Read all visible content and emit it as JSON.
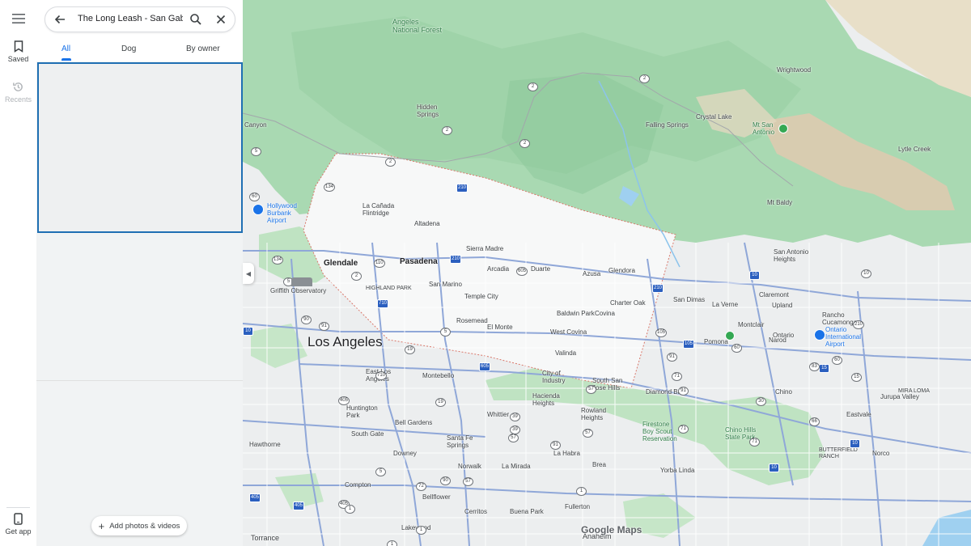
{
  "rail": {
    "saved_label": "Saved",
    "recents_label": "Recents",
    "get_app_label": "Get app"
  },
  "search": {
    "query": "The Long Leash - San Gabriel"
  },
  "tabs": [
    {
      "label": "All",
      "active": true
    },
    {
      "label": "Dog",
      "active": false
    },
    {
      "label": "By owner",
      "active": false
    }
  ],
  "add_photos_label": "Add photos & videos",
  "map": {
    "watermark": "Google Maps",
    "labels": {
      "angeles_forest": "Angeles\nNational Forest",
      "wrightwood": "Wrightwood",
      "hidden_springs": "Hidden\nSprings",
      "falling_springs": "Falling Springs",
      "crystal_lake": "Crystal Lake",
      "mt_san_antonio": "Mt San\nAntonio",
      "lytle_creek": "Lytle Creek",
      "mt_baldy": "Mt Baldy",
      "canyon": "Canyon",
      "hollywood_airport": "Hollywood\nBurbank\nAirport",
      "la_canada": "La Cañada\nFlintridge",
      "altadena": "Altadena",
      "sierra_madre": "Sierra Madre",
      "glendale": "Glendale",
      "pasadena": "Pasadena",
      "arcadia": "Arcadia",
      "duarte": "Duarte",
      "azusa": "Azusa",
      "glendora": "Glendora",
      "san_antonio_heights": "San Antonio\nHeights",
      "griffith": "Griffith Observatory",
      "highland_park": "HIGHLAND PARK",
      "san_marino": "San Marino",
      "temple_city": "Temple City",
      "charter_oak": "Charter Oak",
      "san_dimas": "San Dimas",
      "la_verne": "La Verne",
      "upland": "Upland",
      "rancho": "Rancho\nCucamonga",
      "claremont": "Claremont",
      "baldwin_park": "Baldwin Park",
      "covina": "Covina",
      "rosemead": "Rosemead",
      "el_monte": "El Monte",
      "west_covina": "West Covina",
      "montclair": "Montclair",
      "ontario": "Ontario",
      "ontario_airport": "Ontario\nInternational\nAirport",
      "los_angeles": "Los Angeles",
      "pomona": "Pomona",
      "narod": "Narod",
      "valinda": "Valinda",
      "east_la": "East Los\nAngeles",
      "montebello": "Montebello",
      "city_of_industry": "City of\nIndustry",
      "south_san_jose": "South San\nJose Hills",
      "diamond_bar": "Diamond Bar",
      "chino": "Chino",
      "mira_loma": "MIRA LOMA",
      "hacienda": "Hacienda\nHeights",
      "rowland": "Rowland\nHeights",
      "huntington_park": "Huntington\nPark",
      "bell_gardens": "Bell Gardens",
      "whittier": "Whittier",
      "jurupa": "Jurupa Valley",
      "eastvale": "Eastvale",
      "chino_hills": "Chino Hills\nState Park",
      "south_gate": "South Gate",
      "santa_fe": "Santa Fe\nSprings",
      "firestone": "Firestone\nBoy Scout\nReservation",
      "butterfield": "BUTTERFIELD\nRANCH",
      "norco": "Norco",
      "hawthorne": "Hawthorne",
      "downey": "Downey",
      "norwalk": "Norwalk",
      "la_mirada": "La Mirada",
      "la_habra": "La Habra",
      "brea": "Brea",
      "compton": "Compton",
      "bellflower": "Bellflower",
      "yorba_linda": "Yorba Linda",
      "cerritos": "Cerritos",
      "buena_park": "Buena Park",
      "fullerton": "Fullerton",
      "torrance": "Torrance",
      "lakewood": "Lakewood",
      "anaheim": "Anaheim"
    },
    "shields": [
      "2",
      "2",
      "2",
      "2",
      "2",
      "210",
      "5",
      "134",
      "134",
      "2",
      "110",
      "210",
      "605",
      "210",
      "10",
      "10",
      "710",
      "5",
      "19",
      "60",
      "5",
      "105",
      "105",
      "605",
      "710",
      "19",
      "91",
      "405",
      "90",
      "91",
      "39",
      "91",
      "15",
      "15",
      "10",
      "10",
      "57",
      "71",
      "71",
      "210",
      "66",
      "30",
      "83",
      "10",
      "60",
      "60",
      "71",
      "91",
      "57",
      "57",
      "405",
      "405",
      "405",
      "57",
      "5",
      "72",
      "90",
      "39",
      "1",
      "1",
      "1",
      "1"
    ]
  }
}
